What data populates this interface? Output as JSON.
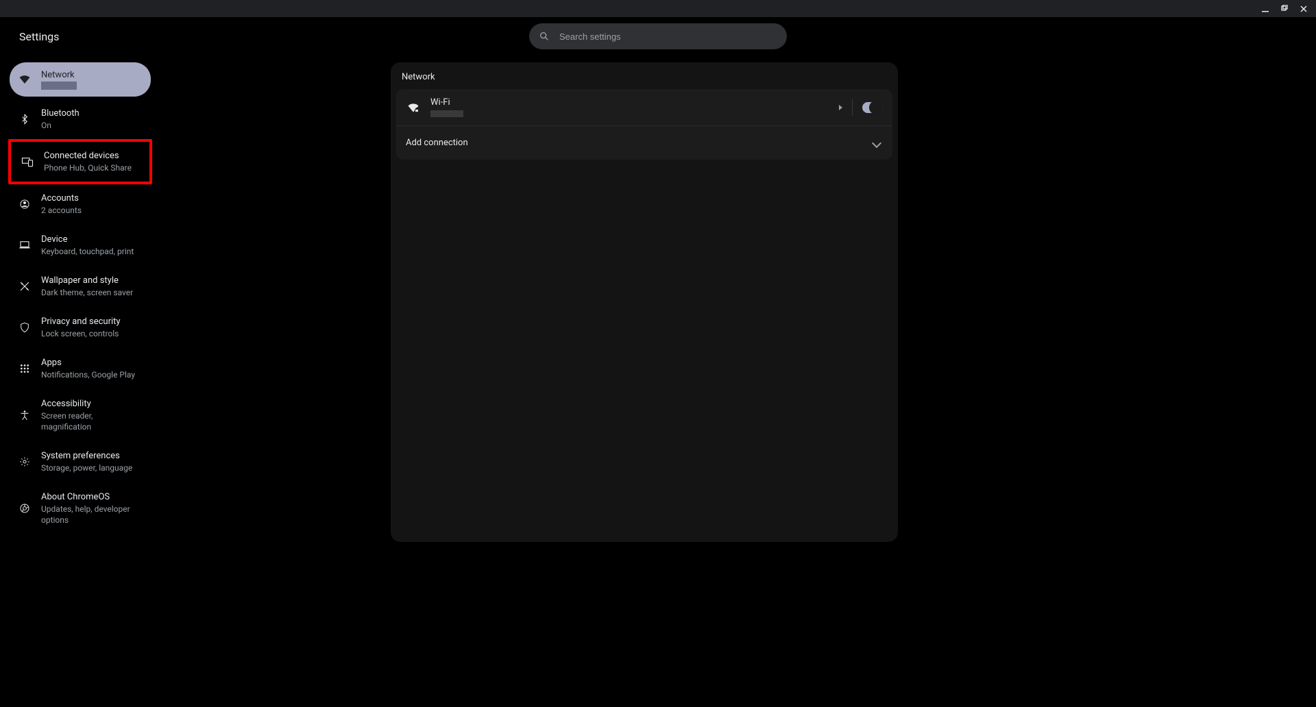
{
  "window": {
    "title": "Settings"
  },
  "search": {
    "placeholder": "Search settings"
  },
  "sidebar": {
    "items": [
      {
        "label": "Network",
        "sublabel_redacted": true
      },
      {
        "label": "Bluetooth",
        "sublabel": "On"
      },
      {
        "label": "Connected devices",
        "sublabel": "Phone Hub, Quick Share"
      },
      {
        "label": "Accounts",
        "sublabel": "2 accounts"
      },
      {
        "label": "Device",
        "sublabel": "Keyboard, touchpad, print"
      },
      {
        "label": "Wallpaper and style",
        "sublabel": "Dark theme, screen saver"
      },
      {
        "label": "Privacy and security",
        "sublabel": "Lock screen, controls"
      },
      {
        "label": "Apps",
        "sublabel": "Notifications, Google Play"
      },
      {
        "label": "Accessibility",
        "sublabel": "Screen reader, magnification"
      },
      {
        "label": "System preferences",
        "sublabel": "Storage, power, language"
      },
      {
        "label": "About ChromeOS",
        "sublabel": "Updates, help, developer options"
      }
    ]
  },
  "main": {
    "section_title": "Network",
    "wifi": {
      "label": "Wi-Fi",
      "name_redacted": true,
      "enabled": true
    },
    "add_connection": "Add connection"
  }
}
